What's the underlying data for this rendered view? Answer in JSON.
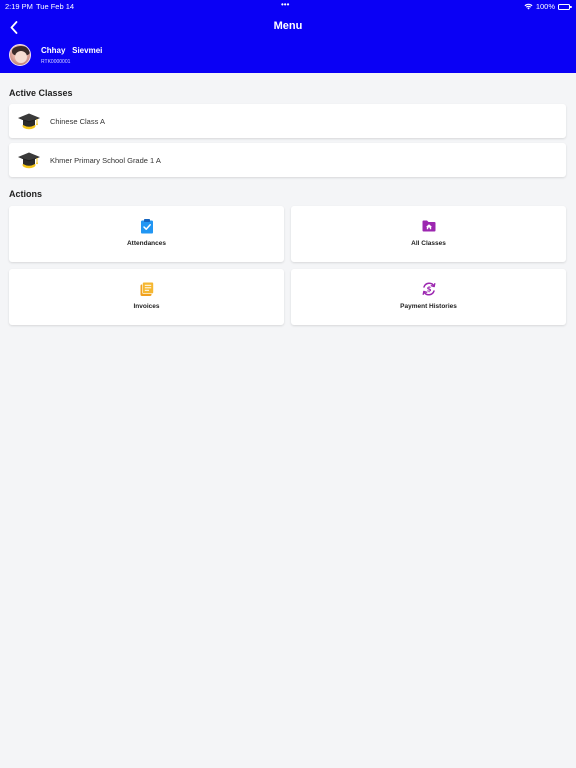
{
  "status_bar": {
    "time": "2:19 PM",
    "date": "Tue Feb 14",
    "dots": "•••",
    "battery": "100%"
  },
  "header": {
    "title": "Menu",
    "user_name": "Chhay   Sievmei",
    "user_id": "RTK0000001",
    "background_color": "#0a00f5"
  },
  "active_classes": {
    "title": "Active Classes",
    "items": [
      {
        "label": "Chinese Class A",
        "icon": "graduation-cap-icon"
      },
      {
        "label": "Khmer Primary School Grade 1 A",
        "icon": "graduation-cap-icon"
      }
    ]
  },
  "actions": {
    "title": "Actions",
    "items": [
      {
        "label": "Attendances",
        "icon": "clipboard-check-icon",
        "color": "#2196f3"
      },
      {
        "label": "All Classes",
        "icon": "folder-home-icon",
        "color": "#9c27b0"
      },
      {
        "label": "Invoices",
        "icon": "documents-icon",
        "color": "#f5a623"
      },
      {
        "label": "Payment Histories",
        "icon": "dollar-cycle-icon",
        "color": "#9c27b0"
      }
    ]
  }
}
